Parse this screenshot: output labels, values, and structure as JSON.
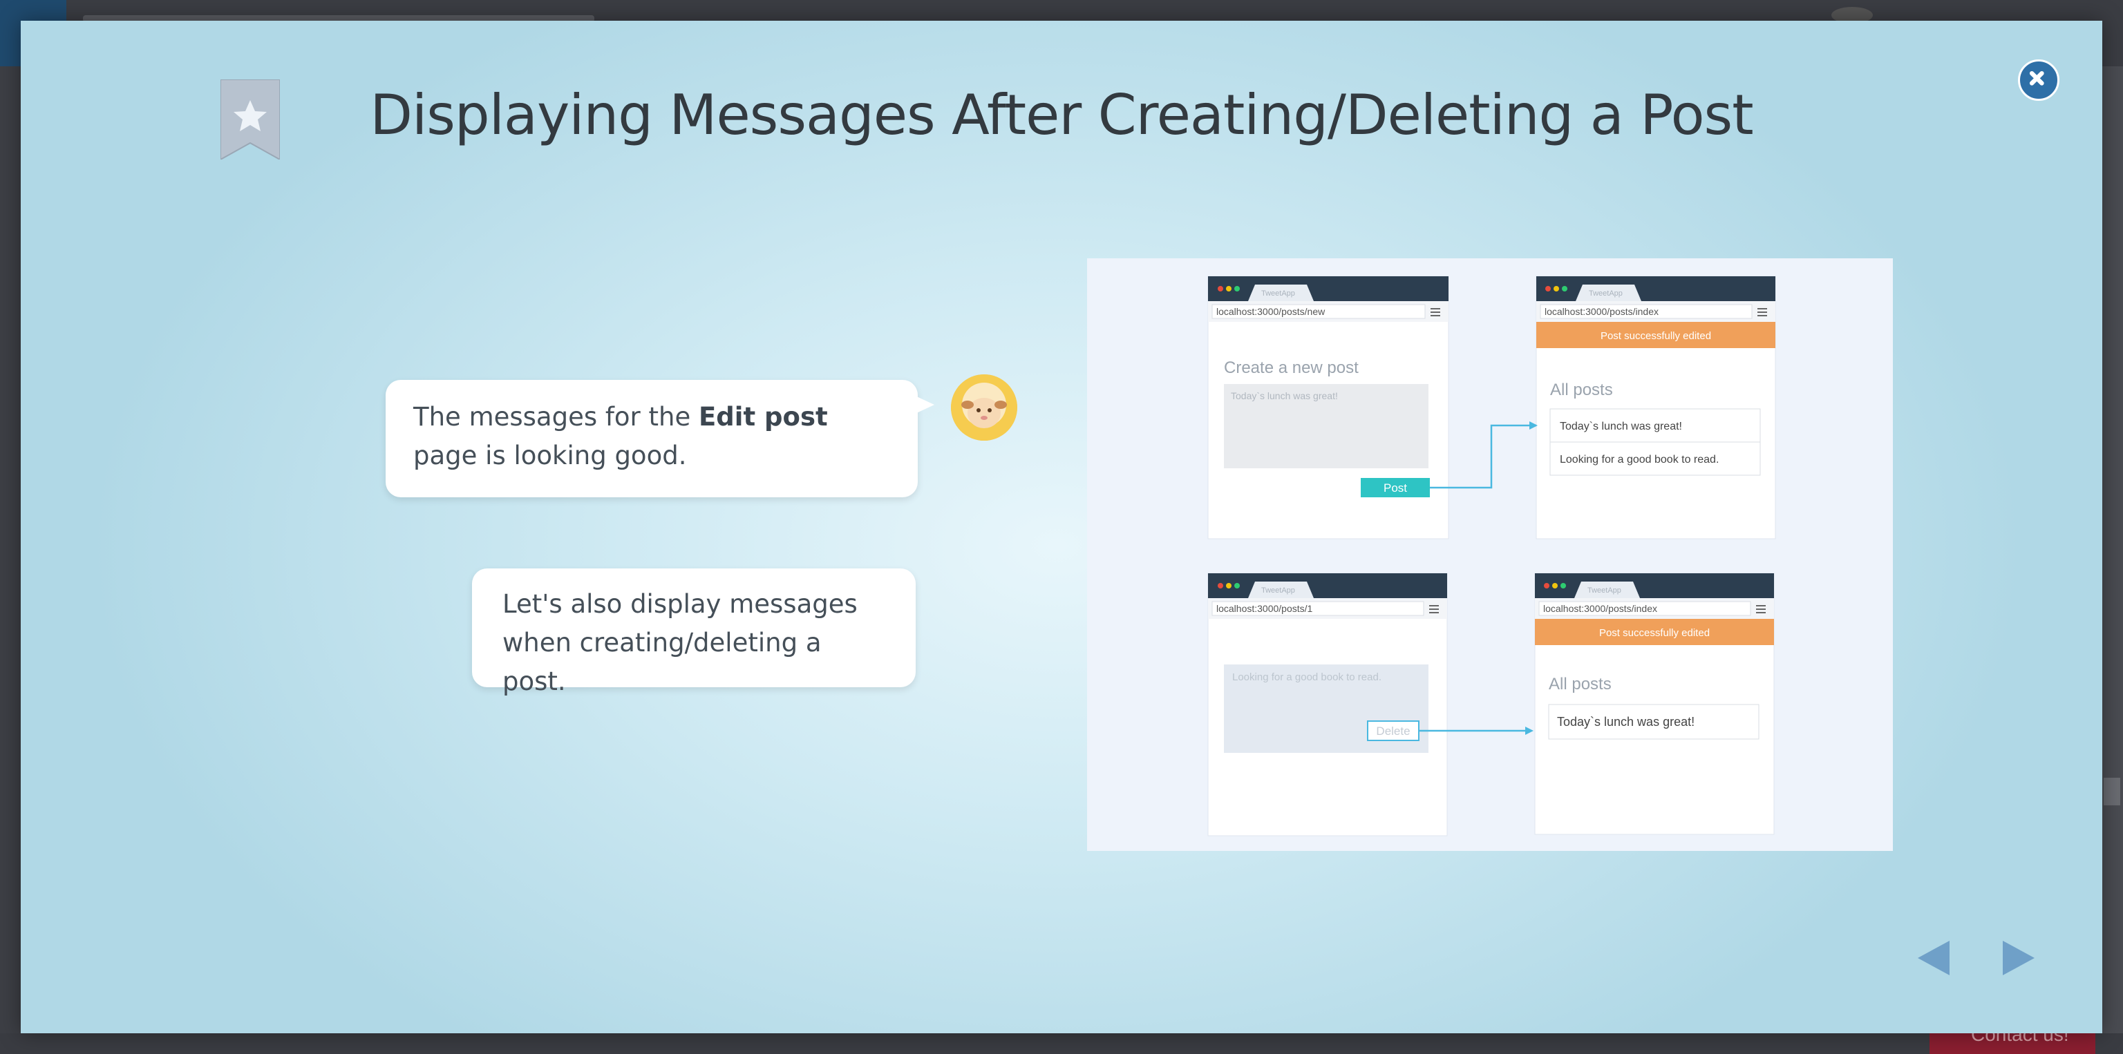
{
  "page": {
    "title": "Displaying Messages After Creating/Deleting a Post"
  },
  "background": {
    "contact_label": "Contact us!"
  },
  "bubbles": {
    "first": {
      "before": "The messages for the ",
      "bold": "Edit post",
      "after": " page is looking good."
    },
    "second": "Let's also display messages when creating/deleting a post."
  },
  "diagram": {
    "browser_tab_label": "TweetApp",
    "panels": {
      "new_post": {
        "url": "localhost:3000/posts/new",
        "heading": "Create a new post",
        "textarea_value": "Today`s lunch was great!",
        "post_button": "Post"
      },
      "index_after_create": {
        "url": "localhost:3000/posts/index",
        "flash": "Post successfully edited",
        "heading": "All posts",
        "items": [
          "Today`s lunch was great!",
          "Looking for a good book to read."
        ]
      },
      "show_post": {
        "url": "localhost:3000/posts/1",
        "content": "Looking for a good book to read.",
        "delete_button": "Delete"
      },
      "index_after_delete": {
        "url": "localhost:3000/posts/index",
        "flash": "Post successfully edited",
        "heading": "All posts",
        "items": [
          "Today`s lunch was great!"
        ]
      }
    }
  },
  "colors": {
    "accent_orange": "#f0a05a",
    "accent_teal": "#2ec4c4",
    "arrow_blue": "#4ab8e0",
    "browser_bar": "#2c3e50",
    "close_button": "#2e6fa7",
    "nav_arrows": "#6fa0c8"
  },
  "icons": {
    "bookmark": "bookmark-star-icon",
    "close": "close-icon",
    "prev": "triangle-left-icon",
    "next": "triangle-right-icon",
    "avatar": "sheep-avatar-icon",
    "menu": "hamburger-menu-icon"
  }
}
